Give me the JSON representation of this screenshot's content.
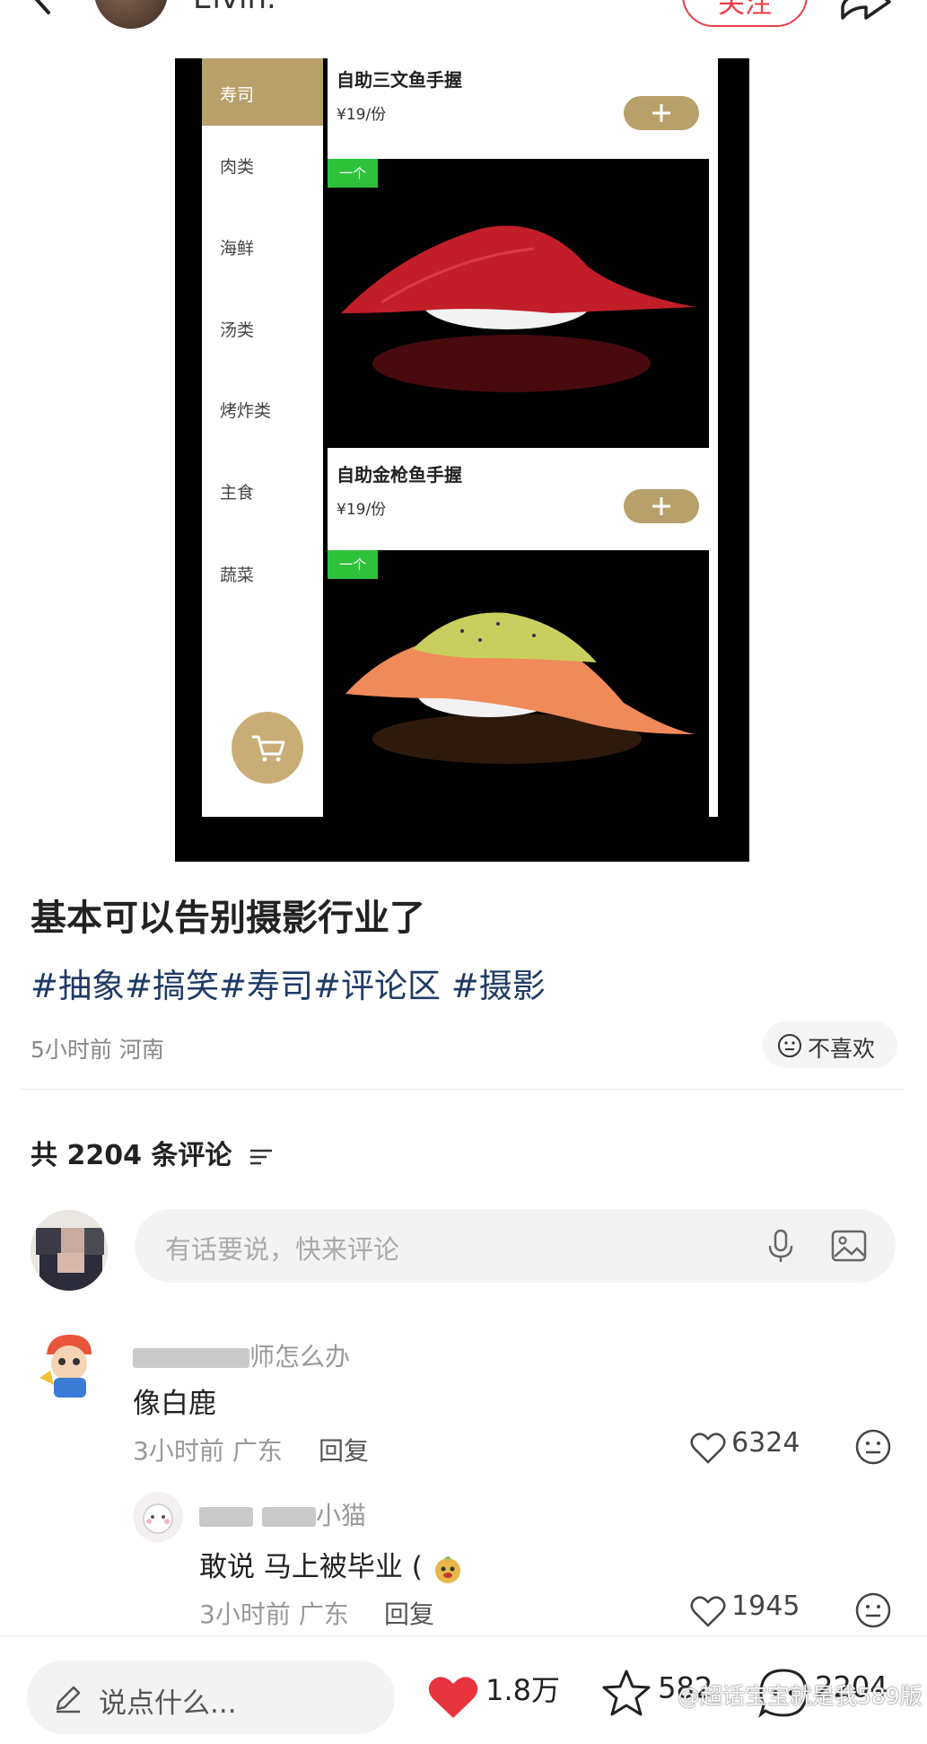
{
  "header": {
    "author_name": "Elvin.",
    "follow_label": "关注"
  },
  "shot": {
    "categories": [
      "寿司",
      "肉类",
      "海鲜",
      "汤类",
      "烤炸类",
      "主食",
      "蔬菜"
    ],
    "dishes": [
      {
        "name": "自助三文鱼手握",
        "price": "¥19/份"
      },
      {
        "name": "自助金枪鱼手握",
        "price": "¥19/份"
      }
    ],
    "badge": "一个"
  },
  "post": {
    "title": "基本可以告别摄影行业了",
    "tags": "#抽象#搞笑#寿司#评论区 #摄影",
    "time_location": "5小时前 河南",
    "dislike_label": "不喜欢"
  },
  "comments_header": {
    "count_label": "共 2204 条评论"
  },
  "comment_input": {
    "placeholder": "有话要说，快来评论"
  },
  "comments": [
    {
      "name_visible": "师怎么办",
      "text": "像白鹿",
      "meta": "3小时前 广东",
      "reply": "回复",
      "likes": "6324"
    },
    {
      "name_visible": "小猫",
      "text": "敢说 马上被毕业 (",
      "meta": "3小时前 广东",
      "reply": "回复",
      "likes": "1945"
    }
  ],
  "bottom_bar": {
    "say_placeholder": "说点什么...",
    "likes": "1.8万",
    "favorites": "582",
    "comments": "2204"
  },
  "watermark": "@超话宝宝就是我589版",
  "colors": {
    "accent_red": "#e7404a",
    "gold": "#b8a06a",
    "tag_blue": "#1f3a66",
    "heart_red": "#e8343f"
  }
}
